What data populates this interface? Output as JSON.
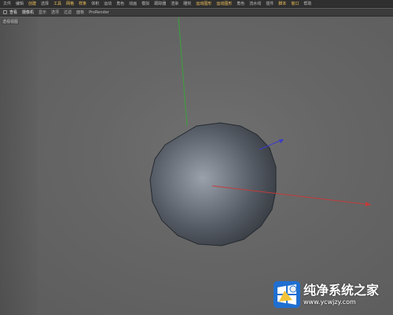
{
  "menu": {
    "items": [
      {
        "label": "文件",
        "highlight": false
      },
      {
        "label": "编辑",
        "highlight": false
      },
      {
        "label": "创建",
        "highlight": true
      },
      {
        "label": "选择",
        "highlight": false
      },
      {
        "label": "工具",
        "highlight": true
      },
      {
        "label": "网格",
        "highlight": true
      },
      {
        "label": "样条",
        "highlight": true
      },
      {
        "label": "体积",
        "highlight": false
      },
      {
        "label": "运动",
        "highlight": false
      },
      {
        "label": "角色",
        "highlight": false
      },
      {
        "label": "动画",
        "highlight": false
      },
      {
        "label": "模拟",
        "highlight": false
      },
      {
        "label": "跟踪器",
        "highlight": false
      },
      {
        "label": "渲染",
        "highlight": false
      },
      {
        "label": "雕刻",
        "highlight": false
      },
      {
        "label": "运动图形",
        "highlight": true
      },
      {
        "label": "运动图形",
        "highlight": true
      },
      {
        "label": "角色",
        "highlight": false
      },
      {
        "label": "流水线",
        "highlight": false
      },
      {
        "label": "插件",
        "highlight": false
      },
      {
        "label": "脚本",
        "highlight": true
      },
      {
        "label": "窗口",
        "highlight": true
      },
      {
        "label": "帮助",
        "highlight": false
      }
    ]
  },
  "viewport_toolbar": {
    "tabs": [
      {
        "label": "查看",
        "strong": true
      },
      {
        "label": "摄像机",
        "strong": true
      },
      {
        "label": "显示",
        "strong": false
      },
      {
        "label": "选项",
        "strong": false
      },
      {
        "label": "过滤",
        "strong": false
      },
      {
        "label": "面板",
        "strong": false
      },
      {
        "label": "ProRender",
        "strong": false
      }
    ]
  },
  "viewport": {
    "label": "透视视图"
  },
  "watermark": {
    "title": "纯净系统之家",
    "url": "www.ycwjzy.com"
  },
  "colors": {
    "menu_bg": "#2f2f2f",
    "menu_highlight": "#f2c25b",
    "viewport_bg": "#666666",
    "sphere": "#5b5f66",
    "axis_x": "#c23b3b",
    "axis_y": "#3aa33a",
    "axis_z": "#3b3bc9"
  },
  "icons": [
    "view-menu-icon",
    "sphere-object",
    "axis-gizmo",
    "brand-logo-icon"
  ]
}
